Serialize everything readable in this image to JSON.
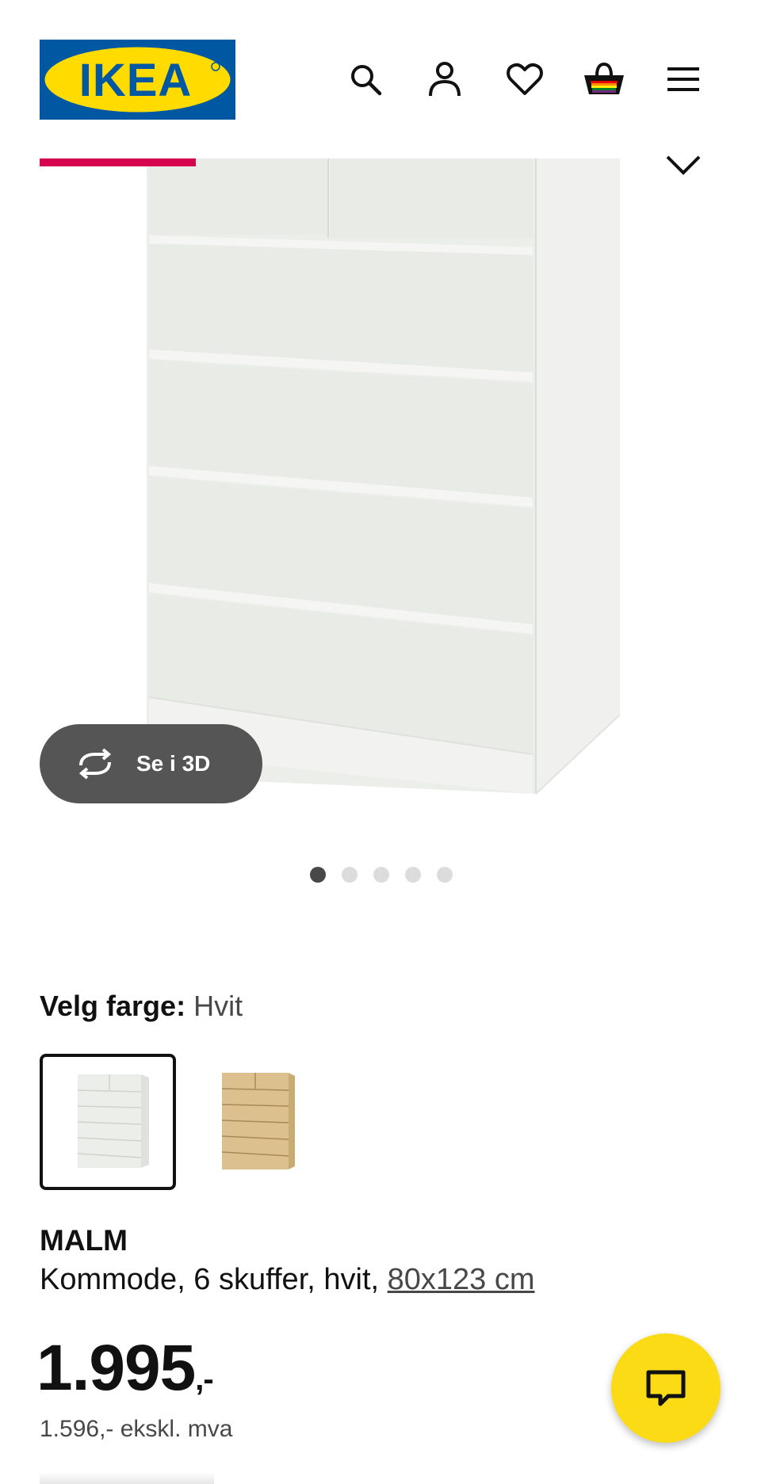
{
  "header": {
    "logo_text": "IKEA",
    "icons": [
      "search-icon",
      "account-icon",
      "heart-icon",
      "basket-icon",
      "menu-icon"
    ]
  },
  "gallery": {
    "see_3d_label": "Se i 3D",
    "dot_count": 5,
    "active_index": 0
  },
  "color_picker": {
    "label": "Velg farge:",
    "selected_value": "Hvit"
  },
  "product": {
    "name": "MALM",
    "description": "Kommode, 6 skuffer, hvit,",
    "dimensions_link": "80x123 cm",
    "price": "1.995",
    "price_suffix": ",-",
    "price_ex_vat": "1.596,- ekskl. mva"
  },
  "colors": {
    "brand_blue": "#0058a3",
    "brand_yellow": "#ffdb00",
    "accent_red": "#d6044f",
    "chat_yellow": "#fadb16",
    "dark_button": "#555555"
  }
}
